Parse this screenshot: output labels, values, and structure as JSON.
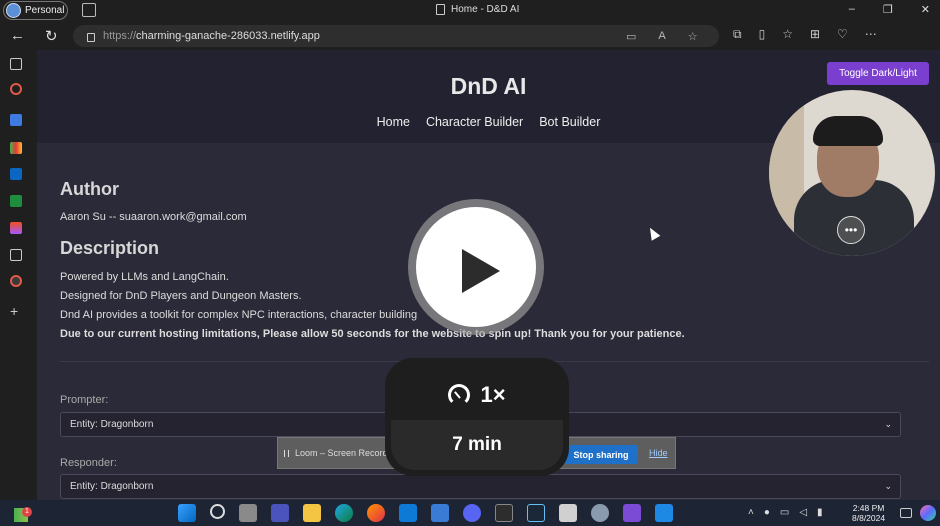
{
  "browser": {
    "profile_label": "Personal",
    "tab_title": "Home - D&D AI",
    "url_protocol": "https://",
    "url_host": "charming-ganache-286033.netlify.app",
    "window_controls": [
      "–",
      "❐",
      "✕"
    ],
    "nav_icons": [
      "back-icon",
      "refresh-icon"
    ]
  },
  "site": {
    "title": "DnD AI",
    "nav": [
      "Home",
      "Character Builder",
      "Bot Builder"
    ],
    "toggle_label": "Toggle Dark/Light"
  },
  "author": {
    "heading": "Author",
    "text": "Aaron Su -- suaaron.work@gmail.com"
  },
  "description": {
    "heading": "Description",
    "line1": "Powered by LLMs and LangChain.",
    "line2": "Designed for DnD Players and Dungeon Masters.",
    "line3": "Dnd AI provides a toolkit for complex NPC interactions, character building",
    "notice": "Due to our current hosting limitations, Please allow 50 seconds for the website to spin up! Thank you for your patience."
  },
  "form": {
    "prompter_label": "Prompter:",
    "prompter_value": "Entity: Dragonborn",
    "responder_label": "Responder:",
    "responder_value": "Entity: Dragonborn"
  },
  "loom": {
    "speed": "1×",
    "duration": "7 min",
    "bar_text": "Loom – Screen Recorde",
    "stop_label": "Stop sharing",
    "hide_label": "Hide",
    "more_glyph": "•••"
  },
  "taskbar": {
    "badge": "1",
    "time": "2:48 PM",
    "date": "8/8/2024",
    "tray_icons": [
      "chevron-up-icon",
      "mic-icon",
      "display-icon",
      "speaker-icon",
      "battery-icon"
    ]
  },
  "colors": {
    "accent": "#7b3fd0",
    "loom_blue": "#1e70c8",
    "page_bg": "#2b2a38",
    "header_bg": "#232230"
  }
}
